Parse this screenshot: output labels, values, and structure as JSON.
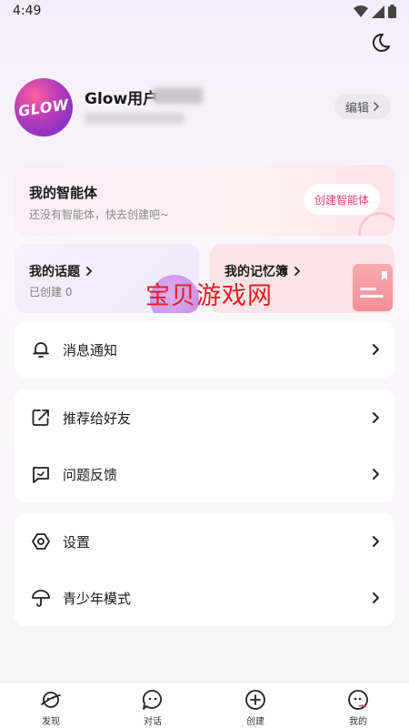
{
  "status_bar": {
    "time": "4:49"
  },
  "profile": {
    "avatar_text": "GLOW",
    "username": "Glow用户",
    "edit_label": "编辑"
  },
  "agent": {
    "title": "我的智能体",
    "subtitle": "还没有智能体，快去创建吧~",
    "create_label": "创建智能体"
  },
  "topics": {
    "title": "我的话题",
    "subtitle": "已创建 0"
  },
  "memo": {
    "title": "我的记忆簿"
  },
  "watermark": "宝贝游戏网",
  "menu": {
    "notifications": "消息通知",
    "recommend": "推荐给好友",
    "feedback": "问题反馈",
    "settings": "设置",
    "teen_mode": "青少年模式"
  },
  "tabs": [
    {
      "label": "发现",
      "icon": "planet-icon"
    },
    {
      "label": "对话",
      "icon": "chat-icon"
    },
    {
      "label": "创建",
      "icon": "plus-circle-icon"
    },
    {
      "label": "我的",
      "icon": "profile-icon"
    }
  ],
  "colors": {
    "accent": "#e8397a",
    "watermark": "#e51d25"
  }
}
